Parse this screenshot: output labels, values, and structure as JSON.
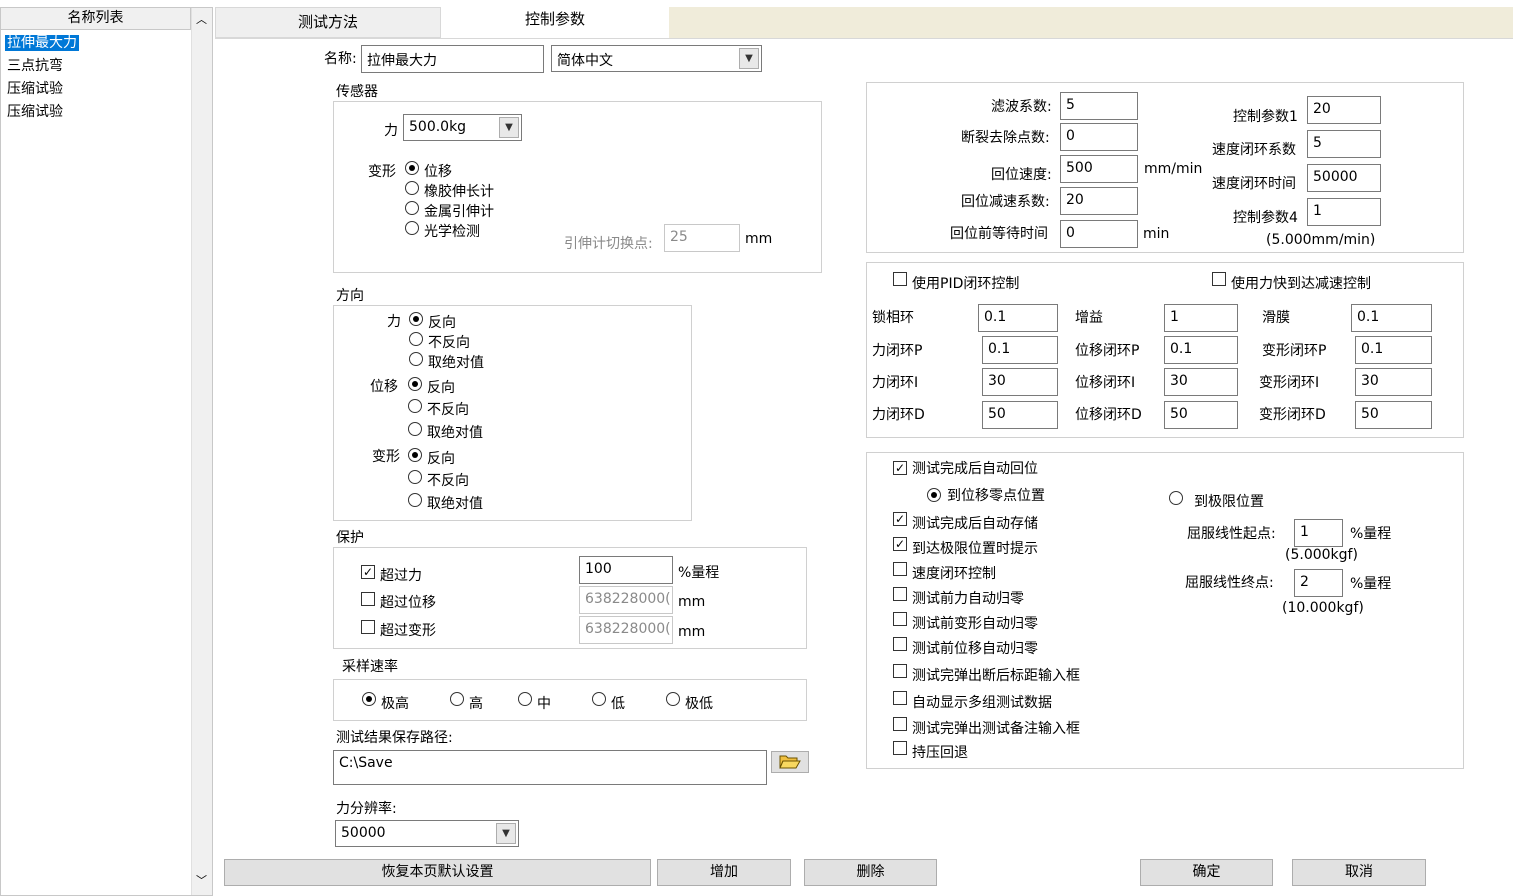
{
  "sidebar": {
    "header": "名称列表",
    "items": [
      {
        "label": "拉伸最大力",
        "selected": true
      },
      {
        "label": "三点抗弯"
      },
      {
        "label": "压缩试验"
      },
      {
        "label": "压缩试验"
      }
    ]
  },
  "tabs": [
    {
      "label": "测试方法"
    },
    {
      "label": "控制参数",
      "active": true
    }
  ],
  "name": {
    "label": "名称:",
    "value": "拉伸最大力",
    "language": "简体中文"
  },
  "sensor": {
    "title": "传感器",
    "force_label": "力",
    "force_value": "500.0kg",
    "deform_label": "变形",
    "options": [
      "位移",
      "橡胶伸长计",
      "金属引伸计",
      "光学检测"
    ],
    "switch_label": "引伸计切换点:",
    "switch_value": "25",
    "switch_unit": "mm"
  },
  "direction": {
    "title": "方向",
    "force_label": "力",
    "disp_label": "位移",
    "deform_label": "变形",
    "options": [
      "反向",
      "不反向",
      "取绝对值"
    ]
  },
  "protect": {
    "title": "保护",
    "over_force": "超过力",
    "over_disp": "超过位移",
    "over_deform": "超过变形",
    "force_value": "100",
    "force_unit": "%量程",
    "disp_value": "638228000(",
    "disp_unit": "mm",
    "deform_value": "638228000(",
    "deform_unit": "mm"
  },
  "sampling": {
    "title": "采样速率",
    "options": [
      "极高",
      "高",
      "中",
      "低",
      "极低"
    ]
  },
  "save": {
    "label": "测试结果保存路径:",
    "path": "C:\\Save"
  },
  "resolution": {
    "label": "力分辨率:",
    "value": "50000"
  },
  "params": {
    "filter_label": "滤波系数:",
    "filter_value": "5",
    "break_label": "断裂去除点数:",
    "break_value": "0",
    "return_speed_label": "回位速度:",
    "return_speed_value": "500",
    "return_speed_unit": "mm/min",
    "return_decel_label": "回位减速系数:",
    "return_decel_value": "20",
    "wait_label": "回位前等待时间",
    "wait_value": "0",
    "wait_unit": "min",
    "ctrl1_label": "控制参数1",
    "ctrl1_value": "20",
    "speed_coef_label": "速度闭环系数",
    "speed_coef_value": "5",
    "speed_time_label": "速度闭环时间",
    "speed_time_value": "50000",
    "ctrl4_label": "控制参数4",
    "ctrl4_value": "1",
    "ctrl4_note": "(5.000mm/min)"
  },
  "pid": {
    "use_pid": "使用PID闭环控制",
    "use_force_fast": "使用力快到达减速控制",
    "rows": [
      [
        {
          "label": "锁相环",
          "value": "0.1"
        },
        {
          "label": "增益",
          "value": "1"
        },
        {
          "label": "滑膜",
          "value": "0.1"
        }
      ],
      [
        {
          "label": "力闭环P",
          "value": "0.1"
        },
        {
          "label": "位移闭环P",
          "value": "0.1"
        },
        {
          "label": "变形闭环P",
          "value": "0.1"
        }
      ],
      [
        {
          "label": "力闭环I",
          "value": "30"
        },
        {
          "label": "位移闭环I",
          "value": "30"
        },
        {
          "label": "变形闭环I",
          "value": "30"
        }
      ],
      [
        {
          "label": "力闭环D",
          "value": "50"
        },
        {
          "label": "位移闭环D",
          "value": "50"
        },
        {
          "label": "变形闭环D",
          "value": "50"
        }
      ]
    ]
  },
  "options": {
    "auto_return": "测试完成后自动回位",
    "to_zero": "到位移零点位置",
    "to_limit": "到极限位置",
    "auto_save": "测试完成后自动存储",
    "limit_prompt": "到达极限位置时提示",
    "speed_loop": "速度闭环控制",
    "force_zero": "测试前力自动归零",
    "deform_zero": "测试前变形自动归零",
    "disp_zero": "测试前位移自动归零",
    "gauge_input": "测试完弹出断后标距输入框",
    "multi_data": "自动显示多组测试数据",
    "remark_input": "测试完弹出测试备注输入框",
    "hold_back": "持压回退",
    "yield_start_label": "屈服线性起点:",
    "yield_start_value": "1",
    "yield_start_unit": "%量程",
    "yield_start_note": "(5.000kgf)",
    "yield_end_label": "屈服线性终点:",
    "yield_end_value": "2",
    "yield_end_unit": "%量程",
    "yield_end_note": "(10.000kgf)"
  },
  "buttons": {
    "restore": "恢复本页默认设置",
    "add": "增加",
    "delete": "删除",
    "ok": "确定",
    "cancel": "取消"
  }
}
